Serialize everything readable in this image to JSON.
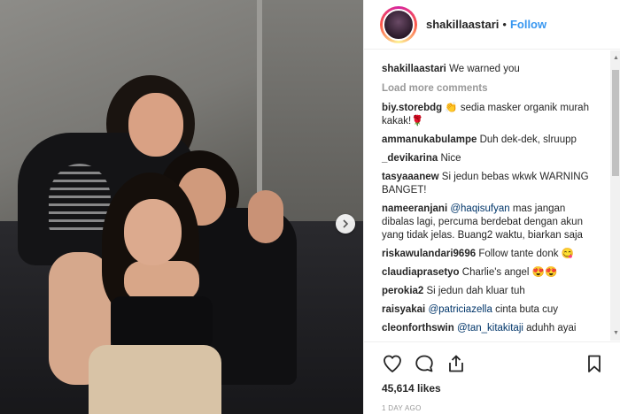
{
  "post": {
    "username": "shakillaastari",
    "follow_label": "Follow",
    "dot": "•",
    "caption_text": "We warned you",
    "load_more": "Load more comments",
    "likes": "45,614 likes",
    "timestamp": "1 DAY AGO"
  },
  "comments": [
    {
      "user": "biy.storebdg",
      "text": "👏 sedia masker organik murah kakak!🌹"
    },
    {
      "user": "ammanukabulampe",
      "text": "Duh dek-dek, slruupp"
    },
    {
      "user": "_devikarina",
      "text": "Nice"
    },
    {
      "user": "tasyaaanew",
      "text": "Si jedun bebas wkwk WARNING BANGET!"
    },
    {
      "user": "nameeranjani",
      "mention": "@haqisufyan",
      "text": "mas jangan dibalas lagi, percuma berdebat dengan akun yang tidak jelas. Buang2 waktu, biarkan saja"
    },
    {
      "user": "riskawulandari9696",
      "text": "Follow tante donk 😋"
    },
    {
      "user": "claudiaprasetyo",
      "text": "Charlie's angel 😍😍"
    },
    {
      "user": "perokia2",
      "text": "Si jedun dah kluar tuh"
    },
    {
      "user": "raisyakai",
      "mention": "@patriciazella",
      "text": "cinta buta cuy"
    },
    {
      "user": "cleonforthswin",
      "mention": "@tan_kitakitaji",
      "text": "aduhh ayai"
    }
  ],
  "icons": {
    "like": "heart-icon",
    "comment": "comment-icon",
    "share": "share-icon",
    "save": "bookmark-icon",
    "next": "chevron-right-icon"
  },
  "colors": {
    "follow": "#3897f0",
    "mention": "#003569",
    "muted": "#999999"
  }
}
